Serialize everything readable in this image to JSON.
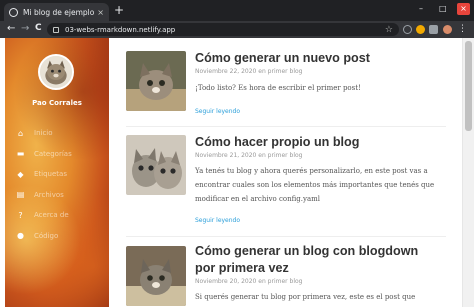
{
  "browser": {
    "tab_title": "Mi blog de ejemplo",
    "url": "03-webs-rmarkdown.netlify.app",
    "new_tab": "+",
    "close_tab": "×",
    "minimize": "–",
    "maximize": "□",
    "close_window": "×",
    "back": "←",
    "forward": "→",
    "reload": "C",
    "star": "☆"
  },
  "sidebar": {
    "author": "Pao Corrales",
    "items": [
      {
        "label": "Inicio",
        "icon": "home-icon",
        "glyph": "⌂"
      },
      {
        "label": "Categorías",
        "icon": "folder-icon",
        "glyph": "▬"
      },
      {
        "label": "Etiquetas",
        "icon": "tags-icon",
        "glyph": "◆"
      },
      {
        "label": "Archivos",
        "icon": "archive-icon",
        "glyph": "▤"
      },
      {
        "label": "Acerca de",
        "icon": "question-icon",
        "glyph": "?"
      },
      {
        "label": "Código",
        "icon": "github-icon",
        "glyph": "●"
      }
    ]
  },
  "posts": [
    {
      "title": "Cómo generar un nuevo post",
      "date": "Noviembre 22, 2020 en primer blog",
      "excerpt": "¡Todo listo? Es hora de escribir el primer post!",
      "more": "Seguir leyendo"
    },
    {
      "title": "Cómo hacer propio un blog",
      "date": "Noviembre 21, 2020 en primer blog",
      "excerpt": "Ya tenés tu blog y ahora querés personalizarlo, en este post vas a encontrar cuales son los elementos más importantes que tenés que modificar en el archivo config.yaml",
      "more": "Seguir leyendo"
    },
    {
      "title": "Cómo generar un blog con blogdown por primera vez",
      "date": "Noviembre 20, 2020 en primer blog",
      "excerpt": "Si querés generar tu blog por primera vez, este es el post que necesitas!",
      "more": ""
    }
  ]
}
